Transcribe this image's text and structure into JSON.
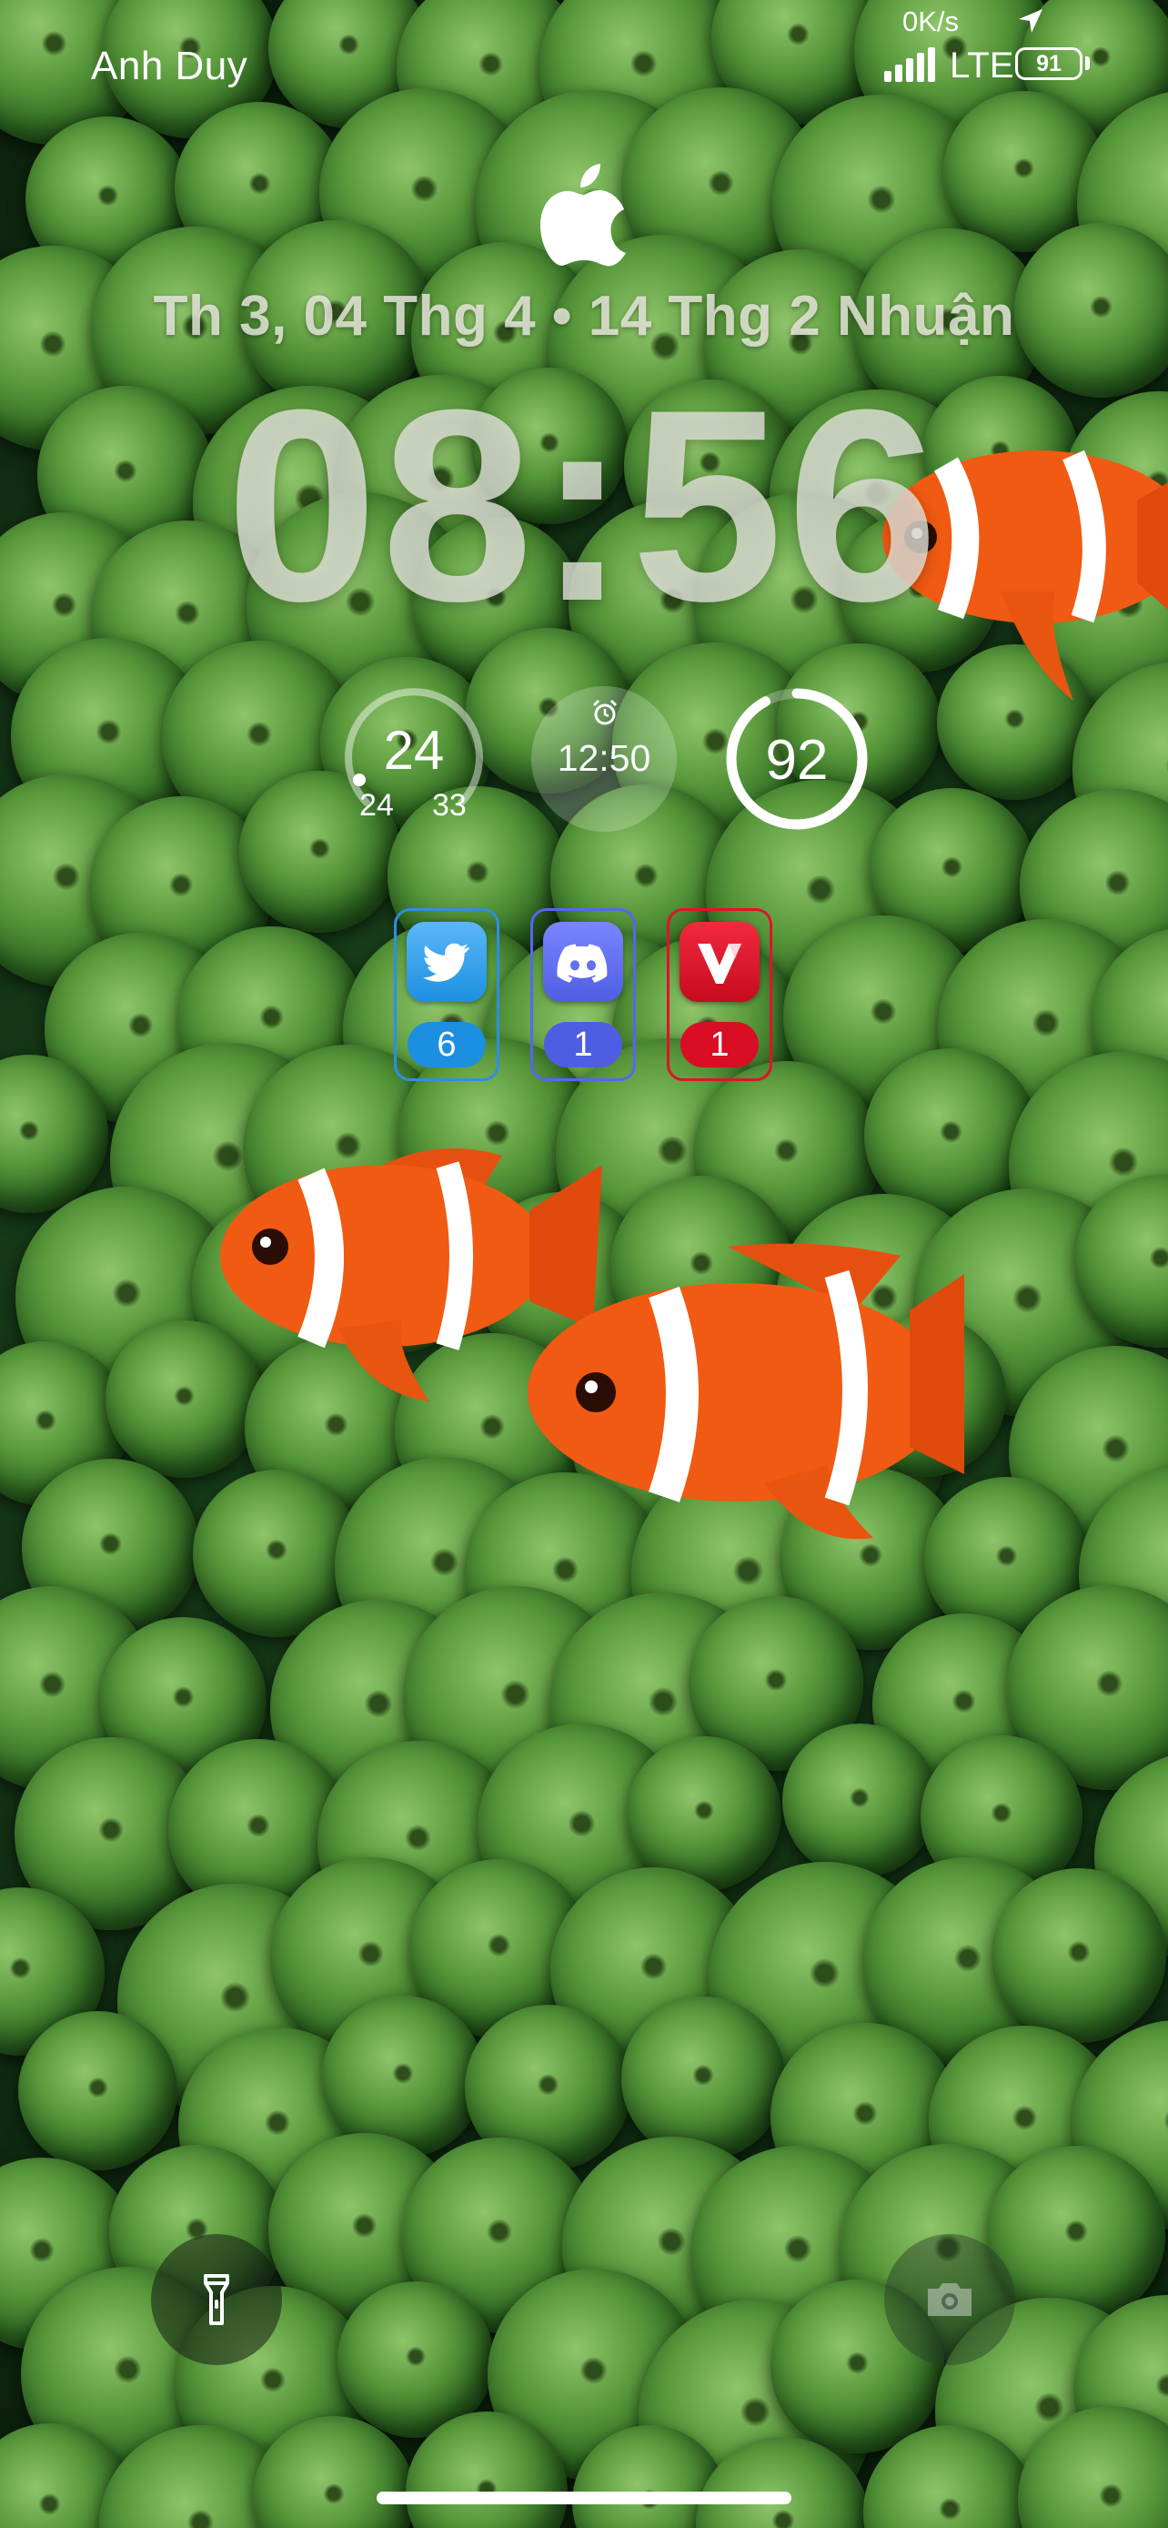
{
  "status_bar": {
    "carrier": "Anh Duy",
    "network_speed": "0K/s",
    "network_type": "LTE",
    "battery_percent": "91",
    "icons": [
      "location-arrow-icon",
      "cellular-signal-icon",
      "battery-icon"
    ]
  },
  "lock_screen": {
    "date": "Th 3, 04 Thg 4 • 14 Thg 2 Nhuận",
    "time": "08:56",
    "logo": "apple-logo-icon"
  },
  "widgets": {
    "weather": {
      "current": "24",
      "low": "24",
      "high": "33",
      "range_fraction": 0.0
    },
    "alarm": {
      "time": "12:50",
      "icon": "alarm-clock-icon"
    },
    "battery": {
      "value": "92",
      "level_fraction": 0.92
    }
  },
  "notifications": [
    {
      "app": "Twitter",
      "icon": "twitter-bird-icon",
      "count": "6",
      "color": "#1d8fe0"
    },
    {
      "app": "Discord",
      "icon": "discord-icon",
      "count": "1",
      "color": "#5865f2"
    },
    {
      "app": "Vivaldi",
      "icon": "vivaldi-icon",
      "count": "1",
      "color": "#e0122a"
    }
  ],
  "bottom_controls": {
    "left": "flashlight-icon",
    "right": "camera-icon"
  },
  "colors": {
    "wallpaper_green": "#2f6b22",
    "clownfish_orange": "#f05a12",
    "twitter_blue": "#1d8fe0",
    "discord_blurple": "#5865f2",
    "vivaldi_red": "#e0122a"
  }
}
